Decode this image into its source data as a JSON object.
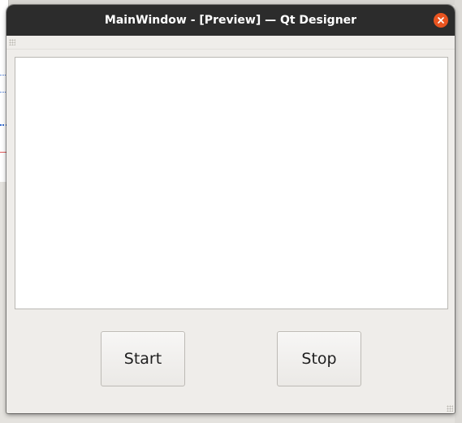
{
  "window": {
    "title": "MainWindow - [Preview] — Qt Designer",
    "close_icon": "close-icon",
    "accent_close": "#e95420",
    "titlebar_color": "#2c2c2c"
  },
  "content": {
    "text_area_value": ""
  },
  "buttons": {
    "start_label": "Start",
    "stop_label": "Stop"
  }
}
